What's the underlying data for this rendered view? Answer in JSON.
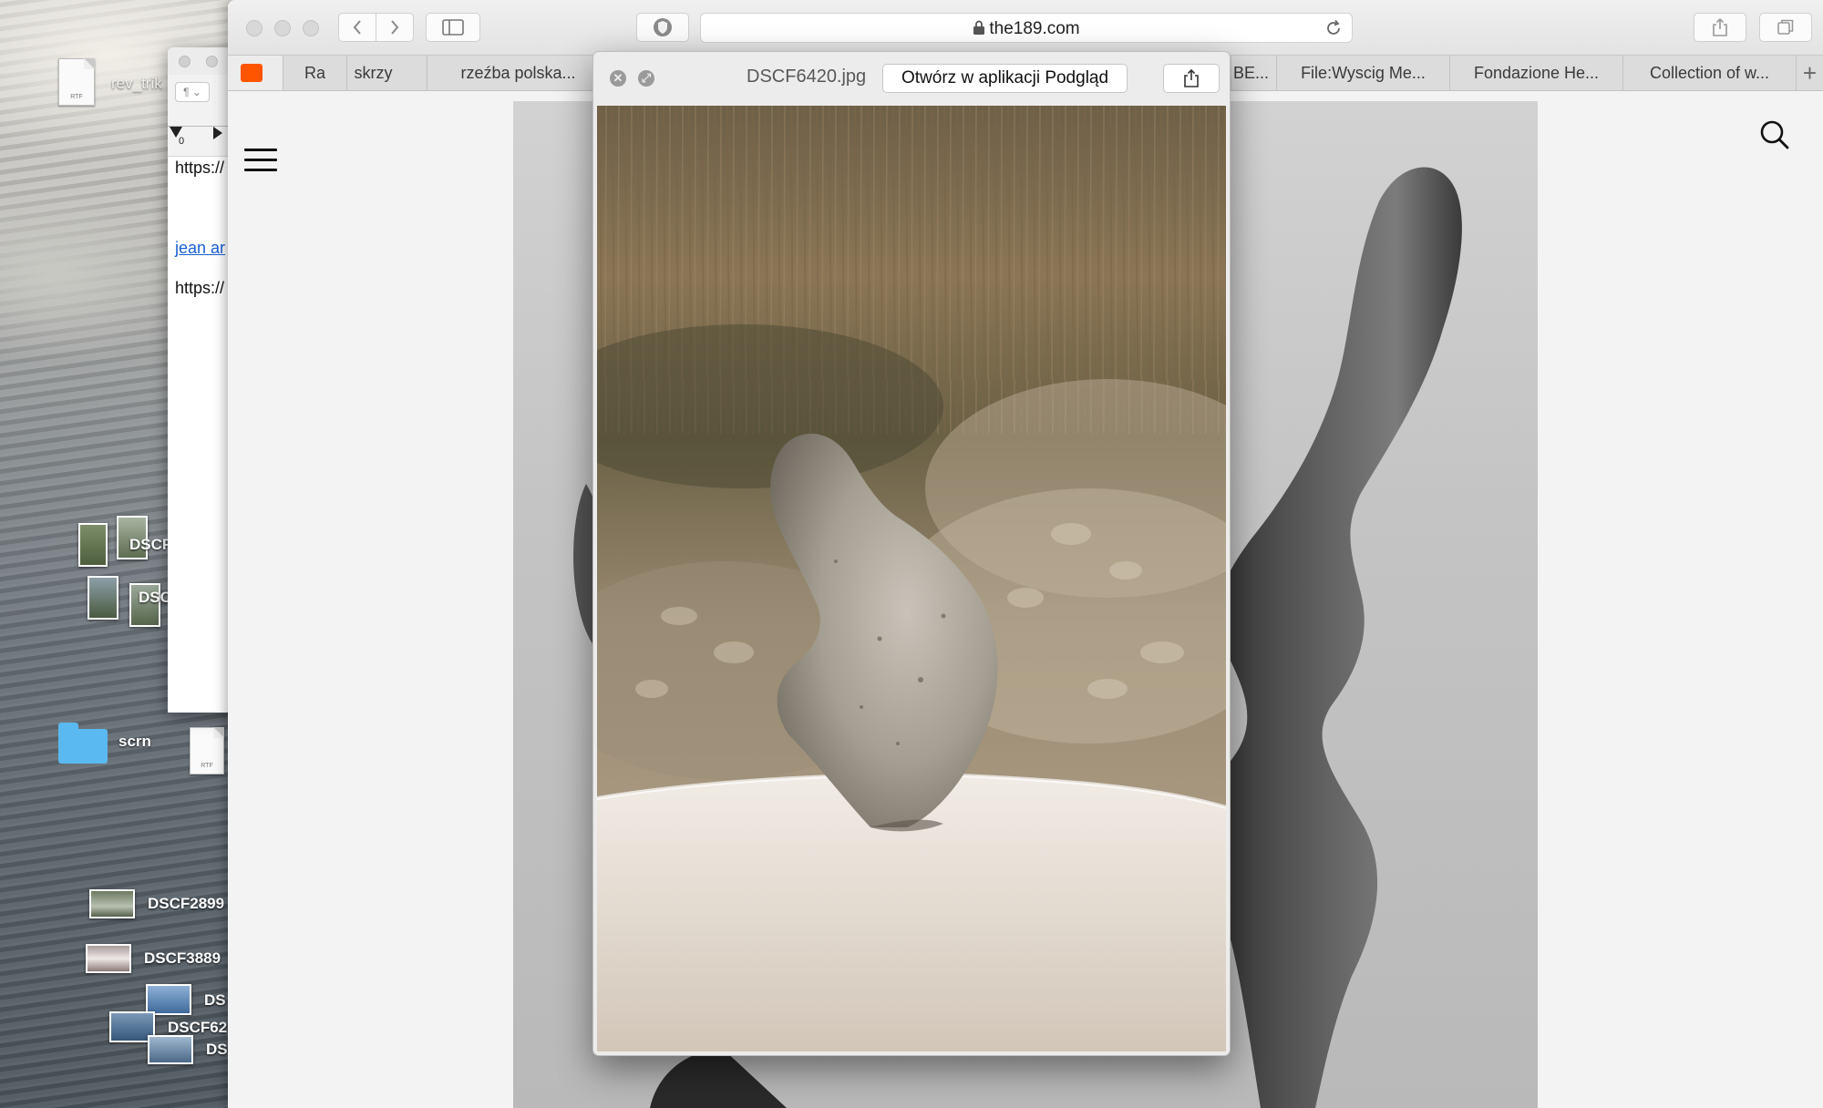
{
  "desktop": {
    "items": [
      {
        "label": "rev_trik",
        "type": "rtf"
      },
      {
        "label": "DSCF",
        "type": "photo"
      },
      {
        "label": "DSC",
        "type": "photo"
      },
      {
        "label": "scrn",
        "type": "folder"
      },
      {
        "label": "DSCF2899",
        "type": "photo"
      },
      {
        "label": "DSCF3889",
        "type": "photo"
      },
      {
        "label": "DS",
        "type": "photo"
      },
      {
        "label": "DSCF62",
        "type": "photo"
      },
      {
        "label": "DS",
        "type": "photo"
      }
    ],
    "rtf_badge": "RTF"
  },
  "textedit": {
    "pilcrow": "¶ ⌄",
    "ruler_zero": "0",
    "lines": [
      "https://",
      "jean ar",
      "https://"
    ]
  },
  "safari": {
    "url": "the189.com",
    "tabs": [
      "Ra",
      "skrzy",
      "rzeźba polska...",
      "BE...",
      "File:Wyscig Me...",
      "Fondazione He...",
      "Collection of w..."
    ],
    "new_tab": "+"
  },
  "quicklook": {
    "filename": "DSCF6420.jpg",
    "open_button": "Otwórz w aplikacji Podgląd",
    "close_glyph": "✕",
    "fullscreen_glyph": "⤢"
  },
  "icons": [
    "lock-icon",
    "reload-icon",
    "share-icon",
    "tabs-overview-icon",
    "sidebar-icon",
    "shield-icon",
    "reader-icon",
    "hamburger-menu-icon",
    "search-icon",
    "soundcloud-icon"
  ]
}
